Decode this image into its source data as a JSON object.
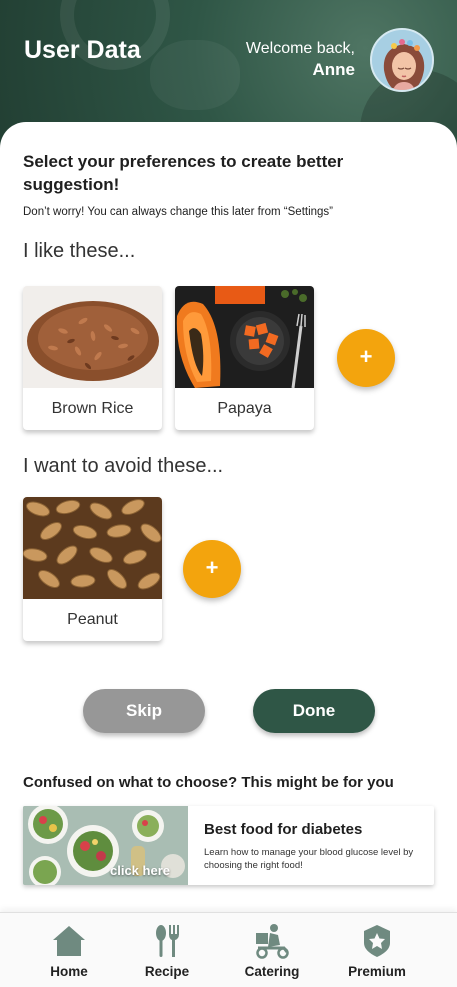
{
  "header": {
    "title": "User Data",
    "welcome": "Welcome back,",
    "username": "Anne"
  },
  "main": {
    "prompt": "Select your preferences to create better suggestion!",
    "note": "Don’t worry! You can always change this later from “Settings”",
    "like_section": {
      "title": "I like these...",
      "items": [
        {
          "name": "Brown Rice"
        },
        {
          "name": "Papaya"
        }
      ],
      "add_label": "+"
    },
    "avoid_section": {
      "title": "I want to avoid these...",
      "items": [
        {
          "name": "Peanut"
        }
      ],
      "add_label": "+"
    },
    "actions": {
      "skip_label": "Skip",
      "done_label": "Done"
    },
    "suggestion": {
      "title": "Confused on what to choose? This might be for you",
      "card_title": "Best food for diabetes",
      "card_desc": "Learn how to manage your blood glucose level by choosing the right food!",
      "card_cta": "click here"
    }
  },
  "bottom_nav": {
    "items": [
      {
        "label": "Home",
        "icon": "home-icon"
      },
      {
        "label": "Recipe",
        "icon": "utensils-icon"
      },
      {
        "label": "Catering",
        "icon": "delivery-scooter-icon"
      },
      {
        "label": "Premium",
        "icon": "premium-badge-icon"
      }
    ]
  },
  "colors": {
    "brand_green": "#2f5646",
    "accent_orange": "#f3a40d",
    "skip_gray": "#979797",
    "icon_gray": "#6f8a80"
  }
}
